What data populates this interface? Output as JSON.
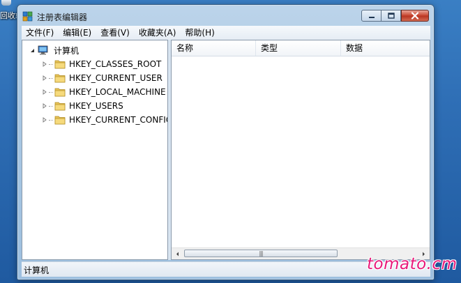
{
  "desktop": {
    "icon_label": "回收站"
  },
  "window": {
    "title": "注册表编辑器",
    "controls": [
      "minimize",
      "maximize",
      "close"
    ]
  },
  "menu": [
    {
      "label": "文件(F)"
    },
    {
      "label": "编辑(E)"
    },
    {
      "label": "查看(V)"
    },
    {
      "label": "收藏夹(A)"
    },
    {
      "label": "帮助(H)"
    }
  ],
  "tree": {
    "root": {
      "label": "计算机",
      "icon": "computer-icon"
    },
    "children": [
      {
        "label": "HKEY_CLASSES_ROOT",
        "icon": "folder-icon"
      },
      {
        "label": "HKEY_CURRENT_USER",
        "icon": "folder-icon"
      },
      {
        "label": "HKEY_LOCAL_MACHINE",
        "icon": "folder-icon"
      },
      {
        "label": "HKEY_USERS",
        "icon": "folder-icon"
      },
      {
        "label": "HKEY_CURRENT_CONFIG",
        "icon": "folder-icon"
      }
    ]
  },
  "list": {
    "columns": [
      {
        "label": "名称"
      },
      {
        "label": "类型"
      },
      {
        "label": "数据"
      }
    ]
  },
  "status": {
    "text": "计算机"
  },
  "watermark": "tomato.cm",
  "colors": {
    "close_button": "#c8452f",
    "watermark": "#e8197a"
  }
}
